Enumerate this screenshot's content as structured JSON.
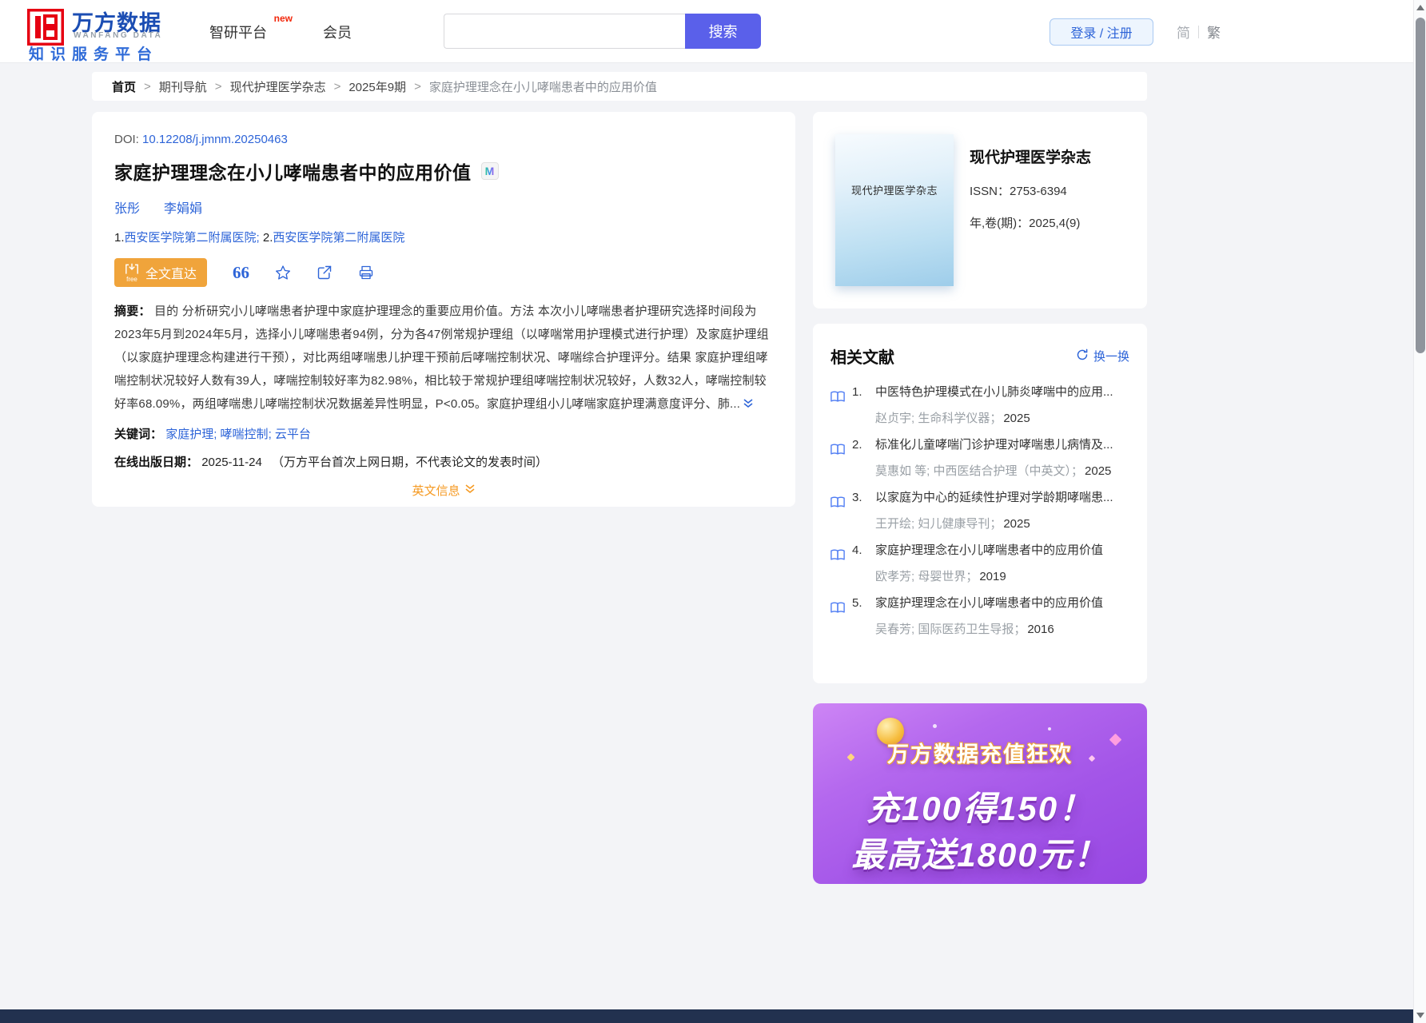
{
  "colors": {
    "link_blue": "#2d64d8",
    "brand_blue": "#1b4db3",
    "logo_red": "#e60012",
    "search_button": "#5a60ea",
    "fulltext_orange": "#f0a43b",
    "english_info_orange": "#f59a23",
    "banner_purple": "#a355e8",
    "footer_navy": "#22314f"
  },
  "header": {
    "logo": {
      "cn": "万方数据",
      "en": "WANFANG DATA",
      "tagline": "知识服务平台"
    },
    "nav": [
      {
        "id": "zhiyan-platform",
        "label": "智研平台",
        "badge": "new"
      },
      {
        "id": "member",
        "label": "会员",
        "badge": ""
      }
    ],
    "search": {
      "value": "",
      "button": "搜索"
    },
    "login": "登录 / 注册",
    "lang": {
      "simplified": "简",
      "traditional": "繁"
    }
  },
  "breadcrumb": {
    "separator": ">",
    "items": [
      "首页",
      "期刊导航",
      "现代护理医学杂志",
      "2025年9期",
      "家庭护理理念在小儿哮喘患者中的应用价值"
    ]
  },
  "article": {
    "doi_label": "DOI:",
    "doi": "10.12208/j.jmnm.20250463",
    "title": "家庭护理理念在小儿哮喘患者中的应用价值",
    "badge": "M",
    "authors": [
      "张彤",
      "李娟娟"
    ],
    "affiliation_separator": "; ",
    "affiliations": [
      {
        "num": "1.",
        "name": "西安医学院第二附属医院"
      },
      {
        "num": "2.",
        "name": "西安医学院第二附属医院"
      }
    ],
    "fulltext_button": "全文直达",
    "fulltext_free": "free",
    "cite_glyph": "66",
    "abstract_label": "摘要：",
    "abstract": "目的 分析研究小儿哮喘患者护理中家庭护理理念的重要应用价值。方法 本次小儿哮喘患者护理研究选择时间段为2023年5月到2024年5月，选择小儿哮喘患者94例，分为各47例常规护理组（以哮喘常用护理模式进行护理）及家庭护理组（以家庭护理理念构建进行干预），对比两组哮喘患儿护理干预前后哮喘控制状况、哮喘综合护理评分。结果 家庭护理组哮喘控制状况较好人数有39人，哮喘控制较好率为82.98%，相比较于常规护理组哮喘控制状况较好，人数32人，哮喘控制较好率68.09%，两组哮喘患儿哮喘控制状况数据差异性明显，P<0.05。家庭护理组小儿哮喘家庭护理满意度评分、肺...",
    "keywords_label": "关键词：",
    "keyword_separator": ";",
    "keywords": [
      "家庭护理",
      "哮喘控制",
      "云平台"
    ],
    "pubdate_label": "在线出版日期：",
    "pubdate": "2025-11-24",
    "pubdate_note": "（万方平台首次上网日期，不代表论文的发表时间）",
    "english_info": "英文信息"
  },
  "journal": {
    "cover_text": "现代护理医学杂志",
    "name": "现代护理医学杂志",
    "issn_label": "ISSN：",
    "issn": "2753-6394",
    "volume_label": "年,卷(期)：",
    "volume": "2025,4(9)"
  },
  "related": {
    "title": "相关文献",
    "refresh": "换一换",
    "items": [
      {
        "num": "1.",
        "title": "中医特色护理模式在小儿肺炎哮喘中的应用...",
        "meta": "赵贞宇; 生命科学仪器；",
        "year": "2025"
      },
      {
        "num": "2.",
        "title": "标准化儿童哮喘门诊护理对哮喘患儿病情及...",
        "meta": "莫惠如 等; 中西医结合护理（中英文）；",
        "year": "2025"
      },
      {
        "num": "3.",
        "title": "以家庭为中心的延续性护理对学龄期哮喘患...",
        "meta": "王开绘; 妇儿健康导刊；",
        "year": "2025"
      },
      {
        "num": "4.",
        "title": "家庭护理理念在小儿哮喘患者中的应用价值",
        "meta": "欧孝芳; 母婴世界；",
        "year": "2019"
      },
      {
        "num": "5.",
        "title": "家庭护理理念在小儿哮喘患者中的应用价值",
        "meta": "吴春芳; 国际医药卫生导报；",
        "year": "2016"
      }
    ]
  },
  "banner": {
    "title": "万方数据充值狂欢",
    "line1": "充100得150！",
    "line2": "最高送1800元！"
  }
}
